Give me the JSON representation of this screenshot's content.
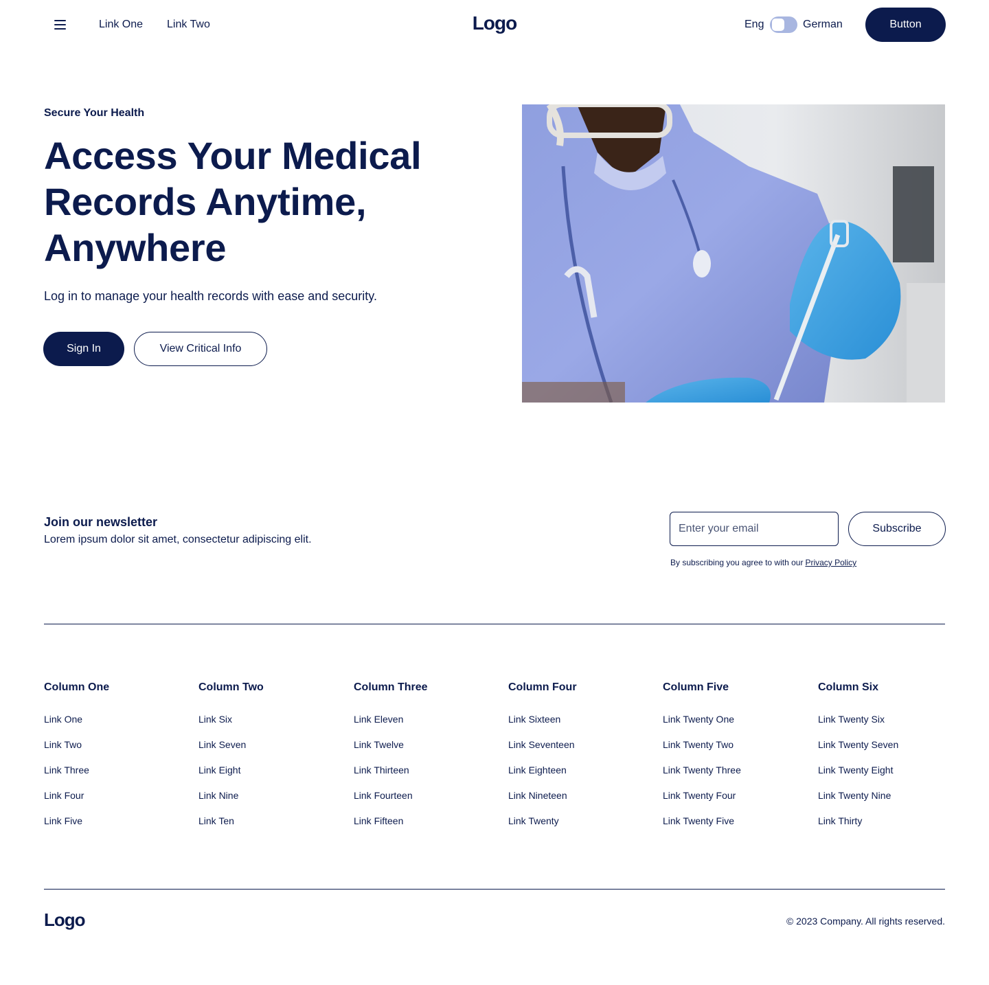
{
  "nav": {
    "links": [
      "Link One",
      "Link Two"
    ],
    "logo": "Logo",
    "lang_left": "Eng",
    "lang_right": "German",
    "button": "Button"
  },
  "hero": {
    "eyebrow": "Secure Your Health",
    "title": "Access Your Medical Records Anytime, Anywhere",
    "subtitle": "Log in to manage your health records with ease and security.",
    "primary_button": "Sign In",
    "secondary_button": "View Critical Info"
  },
  "newsletter": {
    "title": "Join our newsletter",
    "subtitle": "Lorem ipsum dolor sit amet, consectetur adipiscing elit.",
    "placeholder": "Enter your email",
    "button": "Subscribe",
    "terms": "By subscribing you agree to with our",
    "terms_link": "Privacy Policy"
  },
  "footer": {
    "columns": [
      {
        "title": "Column One",
        "links": [
          "Link One",
          "Link Two",
          "Link Three",
          "Link Four",
          "Link Five"
        ]
      },
      {
        "title": "Column Two",
        "links": [
          "Link Six",
          "Link Seven",
          "Link Eight",
          "Link Nine",
          "Link Ten"
        ]
      },
      {
        "title": "Column Three",
        "links": [
          "Link Eleven",
          "Link Twelve",
          "Link Thirteen",
          "Link Fourteen",
          "Link Fifteen"
        ]
      },
      {
        "title": "Column Four",
        "links": [
          "Link Sixteen",
          "Link Seventeen",
          "Link Eighteen",
          "Link Nineteen",
          "Link Twenty"
        ]
      },
      {
        "title": "Column Five",
        "links": [
          "Link Twenty One",
          "Link Twenty Two",
          "Link Twenty Three",
          "Link Twenty Four",
          "Link Twenty Five"
        ]
      },
      {
        "title": "Column Six",
        "links": [
          "Link Twenty Six",
          "Link Twenty Seven",
          "Link Twenty Eight",
          "Link Twenty Nine",
          "Link Thirty"
        ]
      }
    ],
    "logo": "Logo",
    "copyright": "© 2023 Company. All rights reserved."
  },
  "icons": {
    "menu": "hamburger-menu-icon"
  },
  "colors": {
    "primary": "#0c1b4d",
    "toggle": "#a8b6e0",
    "background": "#ffffff"
  }
}
